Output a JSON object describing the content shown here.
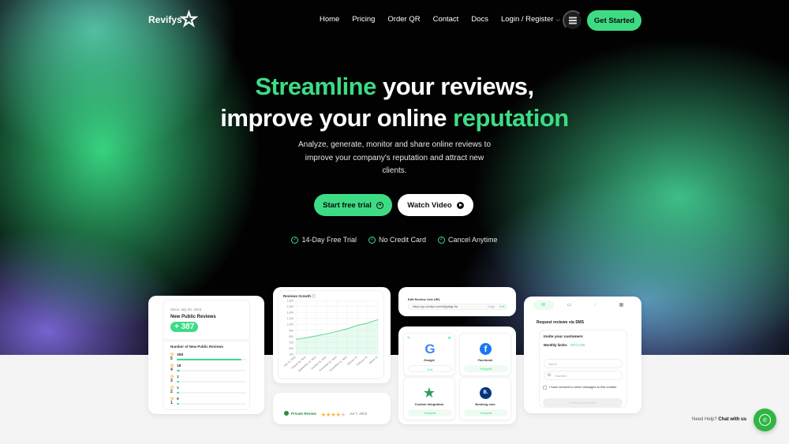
{
  "nav": {
    "brand": "Revifys",
    "links": [
      "Home",
      "Pricing",
      "Order QR",
      "Contact",
      "Docs",
      "Login / Register"
    ],
    "cta": "Get Started"
  },
  "hero": {
    "headline_line1_accent": "Streamline",
    "headline_line1_rest": " your reviews,",
    "headline_line2_rest": "improve your online ",
    "headline_line2_accent": "reputation",
    "subtitle": "Analyze, generate, monitor and share online reviews to improve your company's reputation and attract new clients.",
    "primary_button": "Start free trial",
    "secondary_button": "Watch Video",
    "features": [
      "14-Day Free Trial",
      "No Credit Card",
      "Cancel Anytime"
    ]
  },
  "colors": {
    "accent": "#3ddc84",
    "dark": "#020202"
  },
  "cards": {
    "new_reviews": {
      "since": "Since July 03, 2023",
      "title": "New Public Reviews",
      "badge": "+ 387",
      "section": "Number of New Public Reviews",
      "rows": [
        {
          "stars": "5",
          "count": "358",
          "fraction": 0.93
        },
        {
          "stars": "4",
          "count": "18",
          "fraction": 0.05
        },
        {
          "stars": "3",
          "count": "1",
          "fraction": 0.01
        },
        {
          "stars": "2",
          "count": "1",
          "fraction": 0.01
        },
        {
          "stars": "1",
          "count": "9",
          "fraction": 0.01
        }
      ]
    },
    "growth": {
      "title": "Reviews Growth",
      "y_ticks": [
        "1,354",
        "1,250",
        "1,000",
        "1,100",
        "1,000",
        "900",
        "800",
        "700",
        "600",
        "100"
      ],
      "x_ticks": [
        "July 15, 2023",
        "August 06, 2023",
        "September 14, 2023",
        "October 05, 2023",
        "November 04, 2023",
        "December 01, 2023",
        "January 23",
        "February 23",
        "March 23"
      ],
      "values": [
        780,
        800,
        830,
        860,
        895,
        935,
        985,
        1020,
        1070
      ]
    },
    "private_review": {
      "label": "Private Review",
      "rating": 4,
      "max": 5,
      "date": "Jul 7, 2023"
    },
    "edit_link": {
      "label": "Edit Review Link URL",
      "url": "https://go.revifys.com/rf@ptkgt-5a",
      "copy": "Copy",
      "edit": "Edit"
    },
    "integrations": [
      {
        "name": "Google",
        "button": "Edit"
      },
      {
        "name": "Facebook",
        "button": "Integrate"
      },
      {
        "name": "Custom Integration",
        "button": "Integrate"
      },
      {
        "name": "Booking.com",
        "button": "Integrate"
      }
    ],
    "sms": {
      "title": "Request reviews via SMS",
      "invite": "Invite your customers",
      "limits_label": "Monthly limits:",
      "limits_value": "287/1,000",
      "name_placeholder": "Name",
      "number_placeholder": "Number",
      "consent": "I have consent to send messages to this contact",
      "button": "Request a review"
    }
  },
  "help": {
    "prefix": "Need Help? ",
    "link": "Chat with us"
  }
}
